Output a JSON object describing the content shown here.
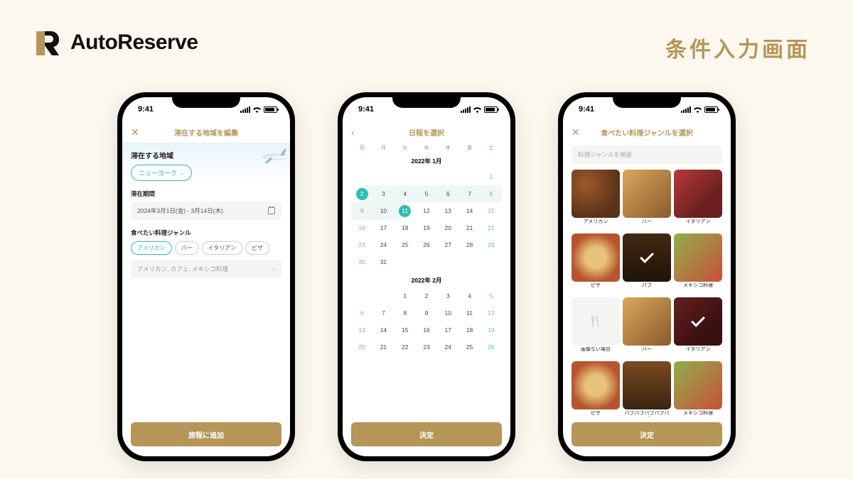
{
  "brand": {
    "name": "AutoReserve"
  },
  "page_title": "条件入力画面",
  "status": {
    "time": "9:41"
  },
  "phone1": {
    "nav_title": "滞在する地域を編集",
    "section_label": "滞在する地域",
    "location_value": "ニューヨーク",
    "period_label": "滞在期間",
    "period_value": "2024年3月1日(金) - 3月14日(木)",
    "genre_label": "食べたい料理ジャンル",
    "chips": [
      "アメリカン",
      "バー",
      "イタリアン",
      "ピザ"
    ],
    "chip_active_index": 0,
    "extra_genre_placeholder": "アメリカン, カフェ, メキシコ料理",
    "primary_button": "旅程に追加"
  },
  "phone2": {
    "nav_title": "日程を選択",
    "dow": [
      "日",
      "月",
      "火",
      "水",
      "木",
      "金",
      "土"
    ],
    "month1_title": "2022年 1月",
    "month2_title": "2022年 2月",
    "primary_button": "決定",
    "range": {
      "start": 2,
      "end": 11
    }
  },
  "phone3": {
    "nav_title": "食べたい料理ジャンルを選択",
    "search_placeholder": "料理ジャンルを検索",
    "genres": [
      {
        "label": "アメリカン",
        "img": "american",
        "checked": false
      },
      {
        "label": "バー",
        "img": "bar",
        "checked": false
      },
      {
        "label": "イタリアン",
        "img": "italian",
        "checked": false
      },
      {
        "label": "ピザ",
        "img": "pizza",
        "checked": false
      },
      {
        "label": "パブ",
        "img": "pub",
        "checked": true
      },
      {
        "label": "メキシコ料理",
        "img": "mexican",
        "checked": false
      },
      {
        "label": "画像ない場合",
        "img": "none",
        "checked": false
      },
      {
        "label": "バー",
        "img": "bar",
        "checked": false
      },
      {
        "label": "イタリアン",
        "img": "italian",
        "checked": true
      },
      {
        "label": "ピザ",
        "img": "pizza",
        "checked": false
      },
      {
        "label": "パブパブパブパブパブ",
        "img": "pub",
        "checked": false
      },
      {
        "label": "メキシコ料理",
        "img": "mexican",
        "checked": false
      }
    ],
    "primary_button": "決定"
  }
}
